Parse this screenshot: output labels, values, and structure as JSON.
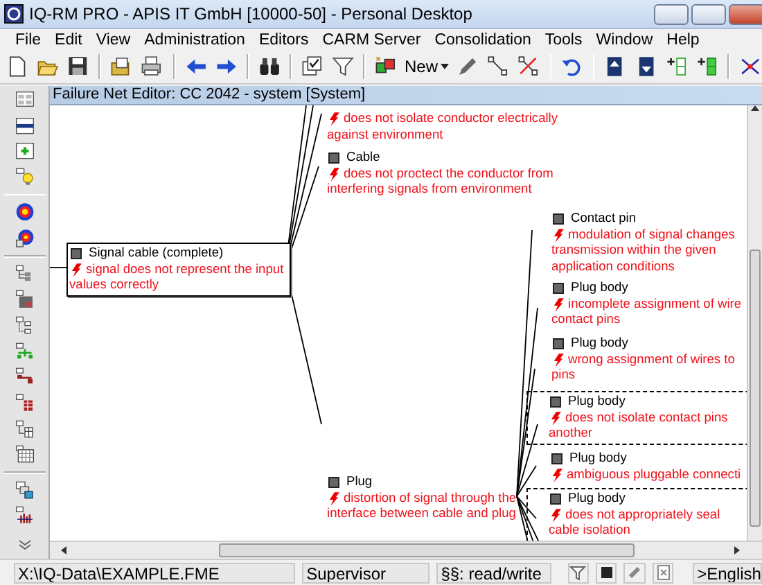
{
  "window": {
    "title": "IQ-RM PRO - APIS IT GmbH [10000-50] - Personal Desktop"
  },
  "menu": [
    "File",
    "Edit",
    "View",
    "Administration",
    "Editors",
    "CARM Server",
    "Consolidation",
    "Tools",
    "Window",
    "Help"
  ],
  "toolbar": {
    "new_button": "New"
  },
  "editor": {
    "title": "Failure Net Editor: CC 2042 - system [System]",
    "nodes": [
      {
        "fault": "does not isolate conductor electrically\nagainst environment",
        "selected": false,
        "marked": false
      },
      {
        "component": "Cable",
        "fault": "does not proctect the conductor from\ninterfering signals from environment",
        "selected": false,
        "marked": false
      },
      {
        "component": "Signal cable (complete)",
        "fault": "signal does not represent the input\nvalues correctly",
        "selected": true,
        "marked": false
      },
      {
        "component": "Plug",
        "fault": "distortion of signal through the\ninterface between cable and plug",
        "selected": false,
        "marked": false
      },
      {
        "component": "Contact pin",
        "fault": "modulation of signal changes\ntransmission within the given\napplication conditions",
        "selected": false,
        "marked": false
      },
      {
        "component": "Plug body",
        "fault": "incomplete assignment of wire\ncontact pins",
        "selected": false,
        "marked": false
      },
      {
        "component": "Plug body",
        "fault": "wrong assignment of wires to\npins",
        "selected": false,
        "marked": false
      },
      {
        "component": "Plug body",
        "fault": "does not isolate contact pins\nanother",
        "selected": false,
        "marked": true
      },
      {
        "component": "Plug body",
        "fault": "ambiguous pluggable connecti",
        "selected": false,
        "marked": false
      },
      {
        "component": "Plug body",
        "fault": "does not appropriately seal\ncable isolation",
        "selected": false,
        "marked": true
      }
    ]
  },
  "status_bar": {
    "path": "X:\\IQ-Data\\EXAMPLE.FME",
    "user": "Supervisor",
    "rights": "§§: read/write",
    "language": ">English"
  }
}
